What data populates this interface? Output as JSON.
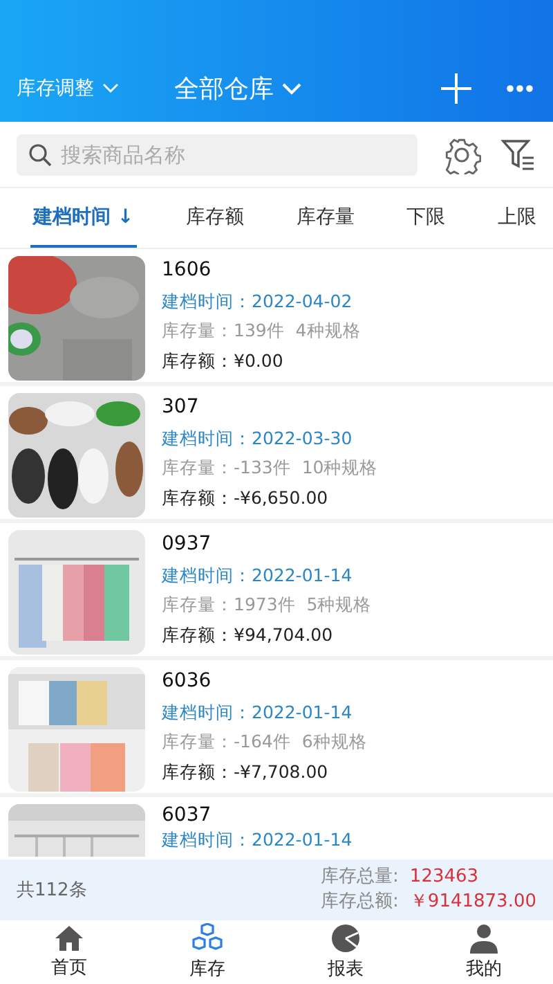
{
  "header": {
    "left_menu": "库存调整",
    "title": "全部仓库"
  },
  "search": {
    "placeholder": "搜索商品名称"
  },
  "sort_tabs": [
    {
      "label": "建档时间",
      "arrow": "↓",
      "selected": true
    },
    {
      "label": "库存额",
      "selected": false
    },
    {
      "label": "库存量",
      "selected": false
    },
    {
      "label": "下限",
      "selected": false
    },
    {
      "label": "上限",
      "selected": false
    }
  ],
  "products": [
    {
      "name": "1606",
      "date_label": "建档时间：",
      "date": "2022-04-02",
      "qty_label": "库存量：",
      "qty": "139件",
      "specs": "4种规格",
      "amount_label": "库存额：",
      "amount": "¥0.00",
      "kind": "picture"
    },
    {
      "name": "307",
      "date_label": "建档时间：",
      "date": "2022-03-30",
      "qty_label": "库存量：",
      "qty": "-133件",
      "specs": "10种规格",
      "amount_label": "库存额：",
      "amount": "-¥6,650.00",
      "kind": "picture"
    },
    {
      "name": "0937",
      "date_label": "建档时间：",
      "date": "2022-01-14",
      "qty_label": "库存量：",
      "qty": "1973件",
      "specs": "5种规格",
      "amount_label": "库存额：",
      "amount": "¥94,704.00",
      "kind": "picture"
    },
    {
      "name": "6036",
      "date_label": "建档时间：",
      "date": "2022-01-14",
      "qty_label": "库存量：",
      "qty": "-164件",
      "specs": "6种规格",
      "amount_label": "库存额：",
      "amount": "-¥7,708.00",
      "kind": "picture"
    },
    {
      "name": "6037",
      "date_label": "建档时间：",
      "date": "2022-01-14",
      "kind": "picture"
    }
  ],
  "summary": {
    "count": "共112条",
    "total_qty_label": "库存总量:",
    "total_qty": "123463",
    "total_amount_label": "库存总额:",
    "total_amount": "￥9141873.00"
  },
  "bottom_nav": [
    {
      "label": "首页",
      "selected": false
    },
    {
      "label": "库存",
      "selected": true
    },
    {
      "label": "报表",
      "selected": false
    },
    {
      "label": "我的",
      "selected": false
    }
  ]
}
